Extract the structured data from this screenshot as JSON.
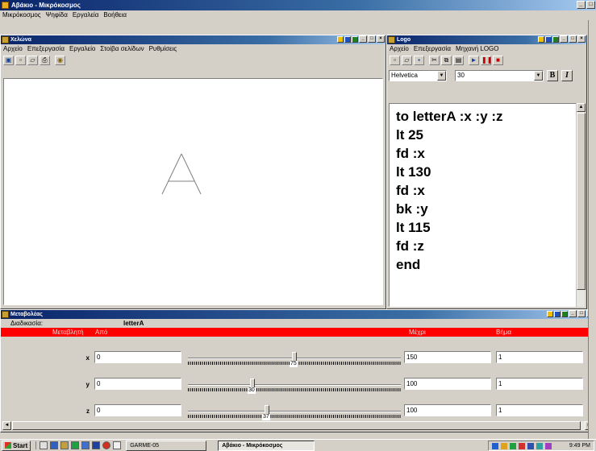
{
  "app": {
    "title": "Αβάκιο - Μικρόκοσμος",
    "menu": [
      "Μικρόκοσμος",
      "Ψηφίδα",
      "Εργαλεία",
      "Βοήθεια"
    ]
  },
  "turtle_window": {
    "title": "Χελώνα",
    "menu": [
      "Αρχείο",
      "Επεξεργασία",
      "Εργαλείο",
      "Στοίβα σελίδων",
      "Ρυθμίσεις"
    ],
    "toolbar": [
      "page-icon",
      "new-icon",
      "open-icon",
      "print-icon",
      "turtle-icon"
    ],
    "drawing": {
      "letter": "A",
      "stroke": "#808080"
    }
  },
  "logo_window": {
    "title": "Logo",
    "menu": [
      "Αρχείο",
      "Επεξεργασία",
      "Μηχανή LOGO"
    ],
    "toolbar": [
      "new-icon",
      "open-icon",
      "save-icon",
      "cut-icon",
      "copy-icon",
      "paste-icon",
      "play-icon",
      "pause-icon",
      "stop-icon"
    ],
    "font": "Helvetica",
    "size": "30",
    "bold_label": "B",
    "italic_label": "I",
    "code": [
      "to letterA :x :y :z",
      "lt 25",
      "fd :x",
      "lt 130",
      "fd :x",
      "bk :y",
      "lt 115",
      "fd :z",
      "end"
    ]
  },
  "variables_window": {
    "title": "Μεταβολέας",
    "procedure_label": "Διαδικασία:",
    "procedure_name": "letterA",
    "headers": {
      "variable": "Μεταβλητή",
      "from": "Από",
      "to": "Μέχρι",
      "step": "Βήμα"
    },
    "rows": [
      {
        "name": "x",
        "from": "0",
        "value": "75",
        "to": "150",
        "step": "1",
        "fraction": 0.5
      },
      {
        "name": "y",
        "from": "0",
        "value": "30",
        "to": "100",
        "step": "1",
        "fraction": 0.3
      },
      {
        "name": "z",
        "from": "0",
        "value": "37",
        "to": "100",
        "step": "1",
        "fraction": 0.37
      }
    ]
  },
  "taskbar": {
    "start": "Start",
    "tasks": [
      "GARME-05",
      "Αβάκιο - Μικρόκοσμος"
    ],
    "clock": "9:49 PM"
  }
}
